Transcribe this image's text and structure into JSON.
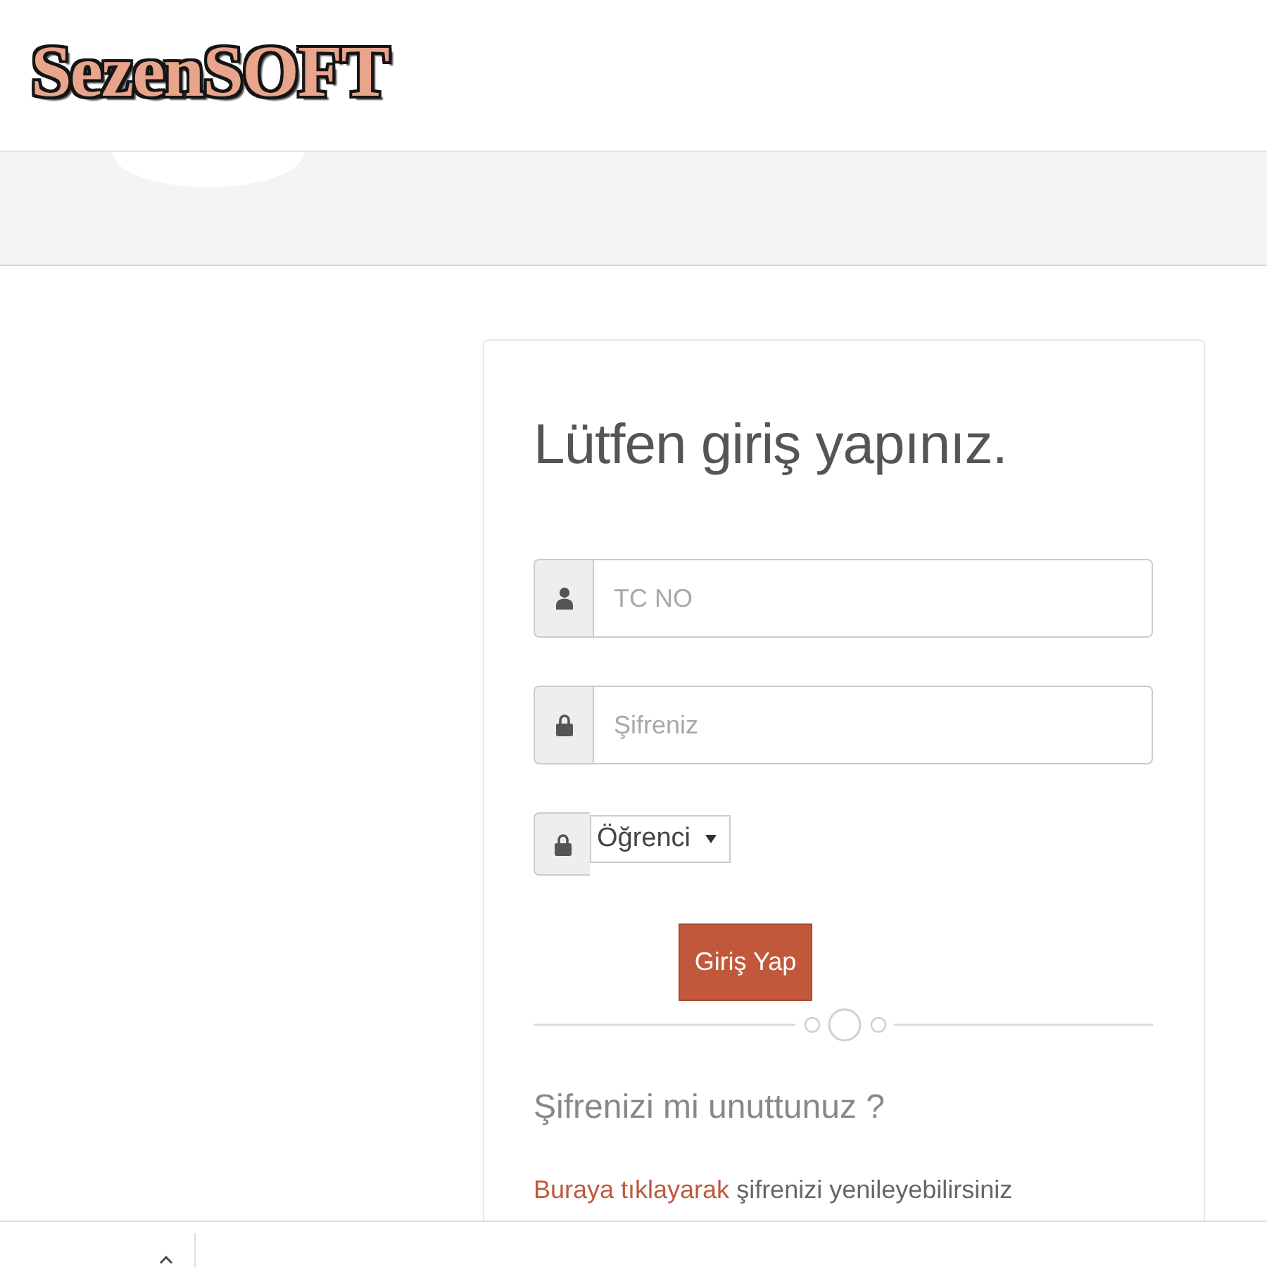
{
  "header": {
    "logo": "SezenSOFT"
  },
  "login_card": {
    "title": "Lütfen giriş yapınız.",
    "fields": [
      {
        "kind": "text",
        "placeholder": "TC NO"
      },
      {
        "kind": "password",
        "placeholder": "Şifreniz"
      },
      {
        "kind": "select",
        "value": "Öğrenci"
      }
    ],
    "submit_button": "Giriş Yap",
    "forgot_heading": "Şifrenizi mi unuttunuz ?",
    "reset_text": {
      "link": "Buraya tıklayarak",
      "text": "şifrenizi yenileyebilirsiniz"
    }
  }
}
